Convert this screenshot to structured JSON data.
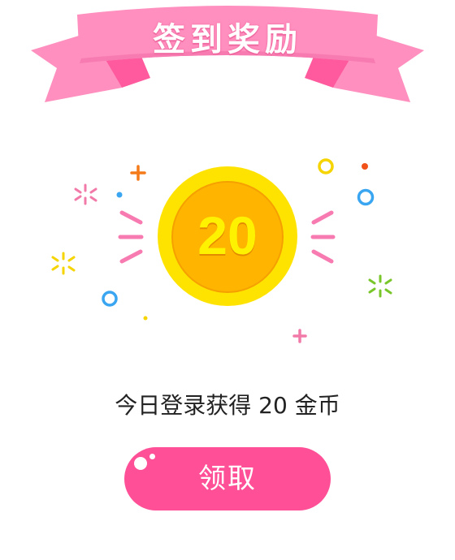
{
  "banner": {
    "title": "签到奖励"
  },
  "coin": {
    "amount": "20"
  },
  "message": "今日登录获得 20 金币",
  "claim_button": {
    "label": "领取"
  },
  "colors": {
    "ribbon_front": "#ff8fbe",
    "ribbon_back": "#ff5a9d",
    "coin_outer": "#ffe300",
    "coin_inner": "#ffb400",
    "button": "#ff4f97",
    "sparkle_pink": "#f27aa9",
    "sparkle_yellow": "#f6d400",
    "sparkle_blue": "#3aa5f0",
    "sparkle_green": "#79c62a",
    "sparkle_orange": "#f47a1a"
  }
}
